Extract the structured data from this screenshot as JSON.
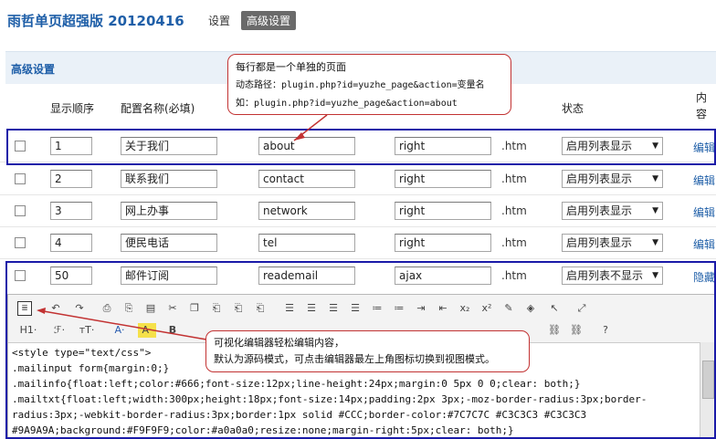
{
  "app": {
    "title": "雨哲单页超强版 20120416"
  },
  "top_tabs": [
    {
      "label": "设置",
      "active": false
    },
    {
      "label": "高级设置",
      "active": true
    }
  ],
  "section": {
    "title": "高级设置"
  },
  "table": {
    "headers": {
      "order": "显示顺序",
      "name": "配置名称(必填)",
      "state": "状态",
      "content": "内容"
    },
    "rows": [
      {
        "order": "1",
        "name": "关于我们",
        "slug": "about",
        "position": "right",
        "ext": ".htm",
        "state": "启用列表显示",
        "action": "编辑"
      },
      {
        "order": "2",
        "name": "联系我们",
        "slug": "contact",
        "position": "right",
        "ext": ".htm",
        "state": "启用列表显示",
        "action": "编辑"
      },
      {
        "order": "3",
        "name": "网上办事",
        "slug": "network",
        "position": "right",
        "ext": ".htm",
        "state": "启用列表显示",
        "action": "编辑"
      },
      {
        "order": "4",
        "name": "便民电话",
        "slug": "tel",
        "position": "right",
        "ext": ".htm",
        "state": "启用列表显示",
        "action": "编辑"
      },
      {
        "order": "50",
        "name": "邮件订阅",
        "slug": "reademail",
        "position": "ajax",
        "ext": ".htm",
        "state": "启用列表不显示",
        "action": "隐藏"
      }
    ]
  },
  "callout_1": {
    "line1": "每行都是一个单独的页面",
    "line2": "动态路径：plugin.php?id=yuzhe_page&action=变量名",
    "line3": "如：plugin.php?id=yuzhe_page&action=about"
  },
  "callout_2": {
    "line1": "可视化编辑器轻松编辑内容，",
    "line2": "默认为源码模式，可点击编辑器最左上角图标切换到视图模式。"
  },
  "editor": {
    "toolbar_row2_labels": {
      "heading": "H1·",
      "font": "ℱ·",
      "size": "тT·",
      "font_color": "A·",
      "bg_color": "A·",
      "bold": "B"
    },
    "code_lines": [
      "<style type=\"text/css\">",
      ".mailinput form{margin:0;}",
      ".mailinfo{float:left;color:#666;font-size:12px;line-height:24px;margin:0 5px 0 0;clear: both;}",
      ".mailtxt{float:left;width:300px;height:18px;font-size:14px;padding:2px 3px;-moz-border-radius:3px;border-",
      "radius:3px;-webkit-border-radius:3px;border:1px solid #CCC;border-color:#7C7C7C #C3C3C3 #C3C3C3",
      "#9A9A9A;background:#F9F9F9;color:#a0a0a0;resize:none;margin-right:5px;clear: both;}"
    ]
  },
  "colors": {
    "accent": "#1f5fa8",
    "highlight_box": "#1a1aa8",
    "callout_border": "#c23232"
  }
}
